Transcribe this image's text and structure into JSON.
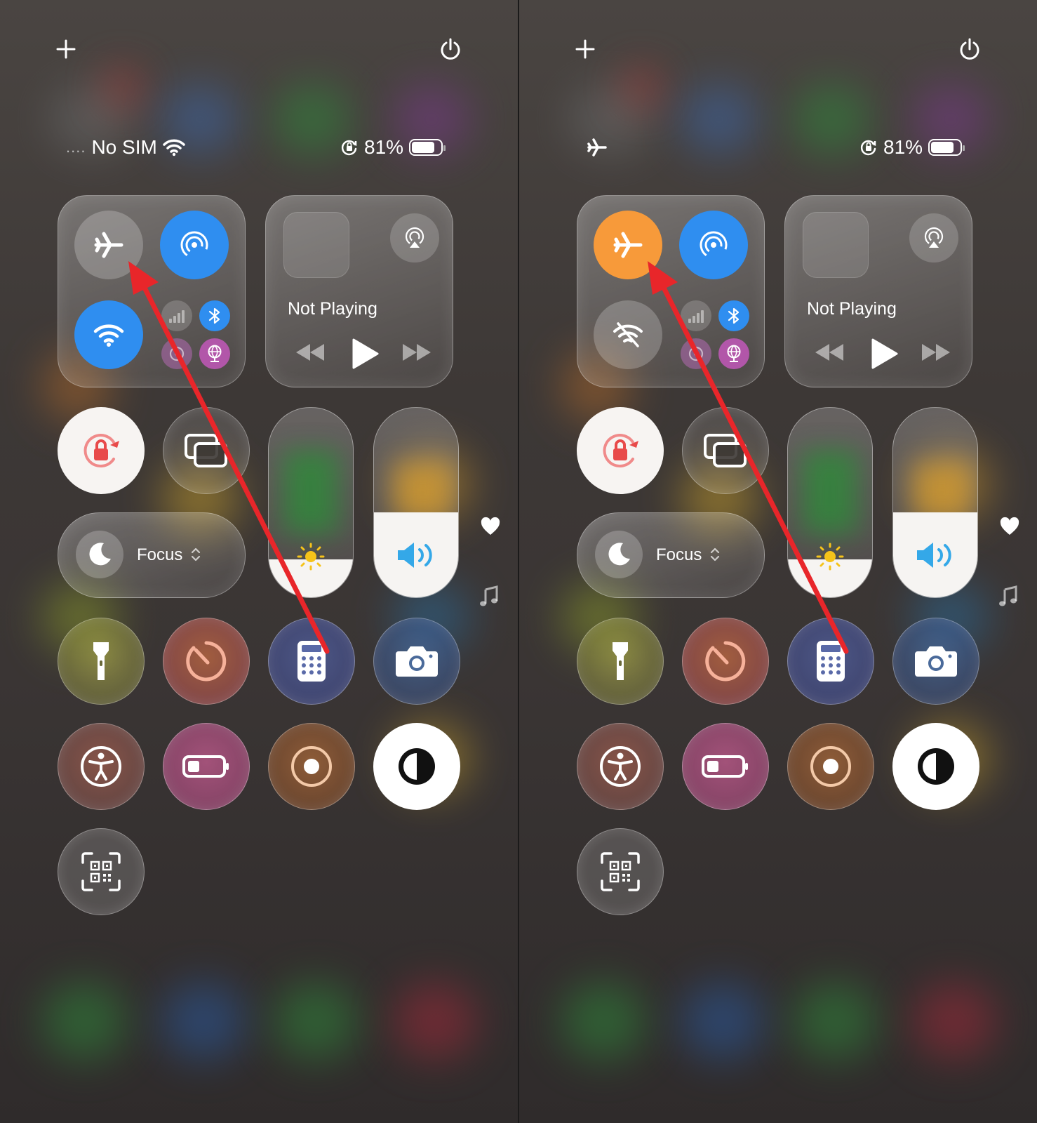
{
  "panels": [
    {
      "id": "before",
      "status": {
        "carrier": "No SIM",
        "show_signal_dots": true,
        "show_wifi": true,
        "show_airplane": false,
        "battery_percent": "81%",
        "battery_level": 0.81
      },
      "connectivity": {
        "airplane_on": false,
        "wifi_on": true,
        "airdrop_on": true,
        "bluetooth_on": true
      },
      "now_playing": {
        "label": "Not Playing"
      },
      "focus": {
        "label": "Focus"
      },
      "brightness_level": 0.2,
      "volume_level": 0.45
    },
    {
      "id": "after",
      "status": {
        "carrier": "",
        "show_signal_dots": false,
        "show_wifi": false,
        "show_airplane": true,
        "battery_percent": "81%",
        "battery_level": 0.81
      },
      "connectivity": {
        "airplane_on": true,
        "wifi_on": false,
        "airdrop_on": true,
        "bluetooth_on": true
      },
      "now_playing": {
        "label": "Not Playing"
      },
      "focus": {
        "label": "Focus"
      },
      "brightness_level": 0.2,
      "volume_level": 0.45
    }
  ],
  "colors": {
    "airplane_active": "#f79a3a",
    "blue_active": "#2f8ef0",
    "arrow": "#e8262a"
  },
  "icons": {
    "add": "plus-icon",
    "power": "power-icon",
    "airplane": "airplane-icon",
    "airdrop": "airdrop-icon",
    "wifi": "wifi-icon",
    "cellular": "cellular-icon",
    "bluetooth": "bluetooth-icon",
    "hotspot": "hotspot-icon",
    "vpn": "vpn-globe-icon",
    "airplay": "airplay-icon",
    "orientation_lock": "orientation-lock-icon",
    "screen_mirroring": "screen-mirroring-icon",
    "focus": "moon-icon",
    "brightness": "sun-icon",
    "volume": "speaker-icon",
    "flashlight": "flashlight-icon",
    "timer": "timer-icon",
    "calculator": "calculator-icon",
    "camera": "camera-icon",
    "accessibility": "accessibility-icon",
    "low_power": "low-power-battery-icon",
    "screen_recording": "screen-recording-icon",
    "dark_mode": "dark-mode-icon",
    "code_scanner": "qr-code-scanner-icon",
    "heart": "heart-icon",
    "music": "music-note-icon"
  }
}
